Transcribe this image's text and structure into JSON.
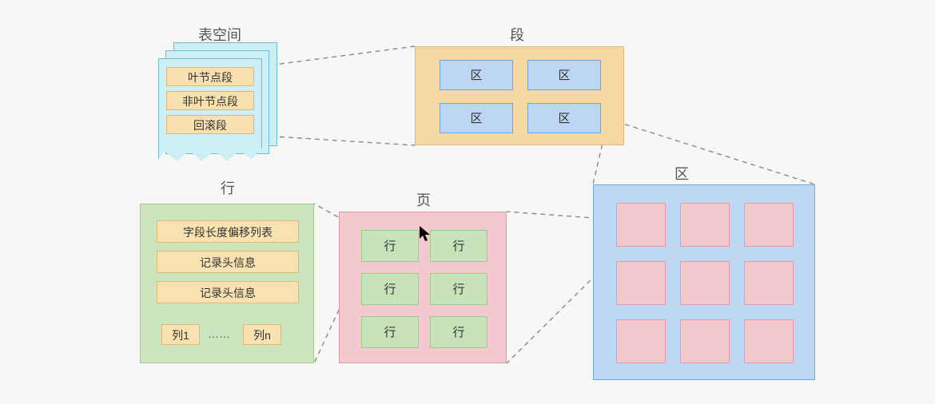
{
  "titles": {
    "tablespace": "表空间",
    "segment": "段",
    "extent": "区",
    "page": "页",
    "row": "行"
  },
  "tablespace": {
    "items": [
      "叶节点段",
      "非叶节点段",
      "回滚段"
    ]
  },
  "segment": {
    "cells": [
      "区",
      "区",
      "区",
      "区"
    ]
  },
  "extent": {
    "cell_count": 9
  },
  "page": {
    "cells": [
      "行",
      "行",
      "行",
      "行",
      "行",
      "行"
    ]
  },
  "row": {
    "items": [
      "字段长度偏移列表",
      "记录头信息",
      "记录头信息"
    ],
    "col_first": "列1",
    "col_dots": "……",
    "col_last": "列n"
  }
}
